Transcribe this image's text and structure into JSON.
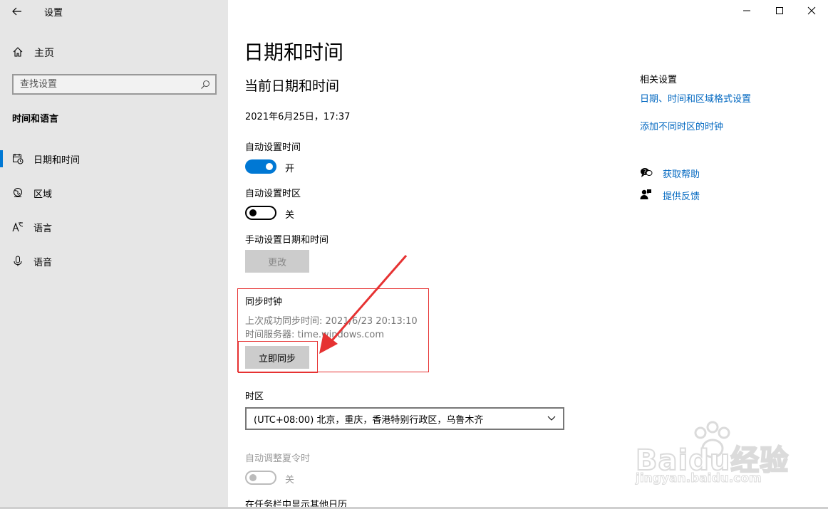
{
  "window": {
    "title": "设置"
  },
  "sidebar": {
    "home_label": "主页",
    "search_placeholder": "查找设置",
    "section_heading": "时间和语言",
    "items": [
      {
        "label": "日期和时间",
        "icon": "calendar-clock-icon",
        "active": true
      },
      {
        "label": "区域",
        "icon": "globe-icon",
        "active": false
      },
      {
        "label": "语言",
        "icon": "language-icon",
        "active": false
      },
      {
        "label": "语音",
        "icon": "microphone-icon",
        "active": false
      }
    ]
  },
  "main": {
    "page_title": "日期和时间",
    "subtitle": "当前日期和时间",
    "current_datetime": "2021年6月25日，17:37",
    "auto_time": {
      "label": "自动设置时间",
      "state_label": "开",
      "on": true
    },
    "auto_timezone": {
      "label": "自动设置时区",
      "state_label": "关",
      "on": false
    },
    "manual": {
      "label": "手动设置日期和时间",
      "button_label": "更改"
    },
    "sync": {
      "heading": "同步时钟",
      "last_sync": "上次成功同步时间: 2021/6/23 20:13:10",
      "server": "时间服务器: time.windows.com",
      "button_label": "立即同步"
    },
    "timezone": {
      "label": "时区",
      "selected": "(UTC+08:00) 北京，重庆，香港特别行政区，乌鲁木齐"
    },
    "dst": {
      "label": "自动调整夏令时",
      "state_label": "关",
      "on": false
    },
    "extra_calendar_label": "在任务栏中显示其他日历"
  },
  "related": {
    "heading": "相关设置",
    "links": [
      "日期、时间和区域格式设置",
      "添加不同时区的时钟"
    ],
    "help_label": "获取帮助",
    "feedback_label": "提供反馈"
  },
  "watermark": {
    "brand": "Baidu经验",
    "url": "jingyan.baidu.com"
  },
  "colors": {
    "accent": "#0078d4",
    "link": "#0067c0",
    "highlight": "#e63232",
    "sidebar_bg": "#e6e6e6"
  }
}
